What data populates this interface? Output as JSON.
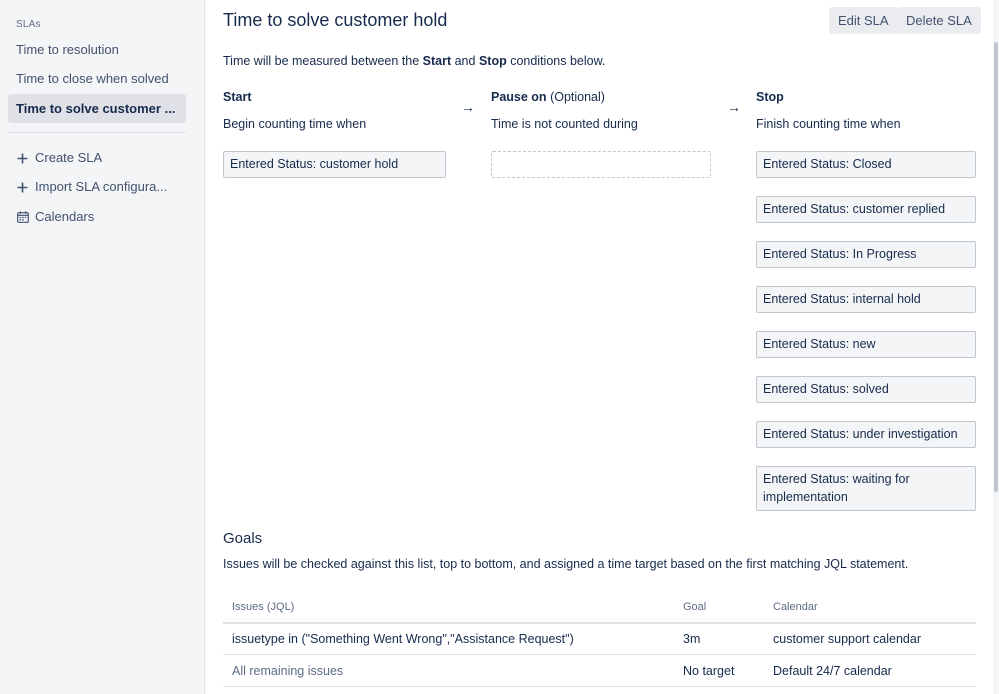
{
  "sidebar": {
    "heading": "SLAs",
    "items": [
      {
        "label": "Time to resolution"
      },
      {
        "label": "Time to close when solved"
      },
      {
        "label": "Time to solve customer ..."
      }
    ],
    "actions": [
      {
        "label": "Create SLA",
        "icon": "plus-icon"
      },
      {
        "label": "Import SLA configura...",
        "icon": "plus-icon"
      },
      {
        "label": "Calendars",
        "icon": "calendar-icon"
      }
    ]
  },
  "header": {
    "title": "Time to solve customer hold",
    "edit_label": "Edit SLA",
    "delete_label": "Delete SLA"
  },
  "intro": {
    "prefix": "Time will be measured between the ",
    "start_word": "Start",
    "middle": " and ",
    "stop_word": "Stop",
    "suffix": " conditions below."
  },
  "columns": {
    "start": {
      "title": "Start",
      "subtitle": "Begin counting time when"
    },
    "pause": {
      "title": "Pause on",
      "optional": "(Optional)",
      "subtitle": "Time is not counted during"
    },
    "stop": {
      "title": "Stop",
      "subtitle": "Finish counting time when"
    },
    "arrow_glyph": "→"
  },
  "start_conditions": [
    "Entered Status: customer hold"
  ],
  "stop_conditions": [
    "Entered Status: Closed",
    "Entered Status: customer replied",
    "Entered Status: In Progress",
    "Entered Status: internal hold",
    "Entered Status: new",
    "Entered Status: solved",
    "Entered Status: under investigation",
    "Entered Status: waiting for implementation"
  ],
  "goals": {
    "title": "Goals",
    "description": "Issues will be checked against this list, top to bottom, and assigned a time target based on the first matching JQL statement.",
    "headers": {
      "issues": "Issues (JQL)",
      "goal": "Goal",
      "calendar": "Calendar"
    },
    "rows": [
      {
        "issues": "issuetype in (\"Something Went Wrong\",\"Assistance Request\")",
        "goal": "3m",
        "calendar": "customer support calendar"
      },
      {
        "issues": "All remaining issues",
        "goal": "No target",
        "calendar": "Default 24/7 calendar"
      }
    ]
  },
  "colors": {
    "sidebar_bg": "#f4f5f7",
    "text": "#172b4d",
    "muted": "#5e6c84",
    "button_bg": "#ebecf0"
  }
}
